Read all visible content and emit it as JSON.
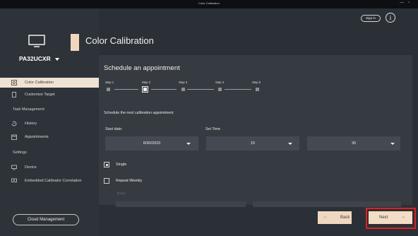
{
  "window": {
    "title": "Color Calibration",
    "minimize": "—",
    "restore": "▫"
  },
  "device": {
    "model": "PA32UCXR"
  },
  "sidebar": {
    "items": [
      {
        "label": "Color Calibration",
        "icon": "calibration-icon",
        "active": true
      },
      {
        "label": "Customize Target",
        "icon": "target-icon",
        "active": false
      }
    ],
    "task_section": "Task Management",
    "task_items": [
      {
        "label": "History",
        "icon": "history-icon"
      },
      {
        "label": "Appointments",
        "icon": "calendar-icon"
      }
    ],
    "settings_section": "Settings",
    "settings_items": [
      {
        "label": "Device",
        "icon": "monitor-icon"
      },
      {
        "label": "Embedded Calibrator Correlation",
        "icon": "calibrator-icon"
      }
    ],
    "cloud_button": "Cloud Management"
  },
  "header": {
    "title": "Color Calibration",
    "signin": "Sign in",
    "info": "i"
  },
  "schedule": {
    "title": "Schedule an appointment",
    "steps": [
      "Step 1",
      "Step 2",
      "Step 3",
      "Step 4",
      "Step 5"
    ],
    "current_step": 2,
    "description": "Schedule the next calibration appointment",
    "start_label": "Start date:",
    "time_label": "Set Time",
    "date_value": "8/30/2023",
    "hour_value": "15",
    "minute_value": "30",
    "single_label": "Single",
    "single_checked": true,
    "weekly_label": "Repeat Weekly",
    "weekly_checked": false,
    "every_label": "Every"
  },
  "footer": {
    "back": "Back",
    "back_arrow": "←",
    "next": "Next",
    "next_arrow": "→"
  },
  "colors": {
    "accent": "#f0d8c0",
    "highlight": "#e0201f",
    "background": "#2b2f36",
    "panel": "#363a41"
  }
}
